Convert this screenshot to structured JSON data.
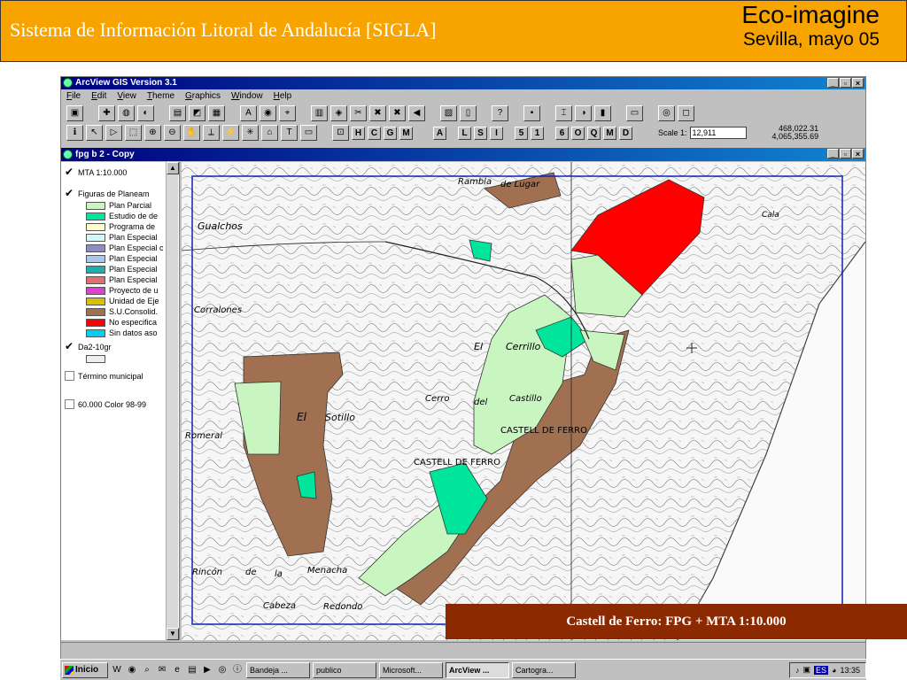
{
  "slide": {
    "title": "Sistema de Información Litoral de Andalucía [SIGLA]",
    "brand": "Eco-imagine",
    "place_date": "Sevilla, mayo 05",
    "caption": "Castell de Ferro: FPG + MTA 1:10.000"
  },
  "app": {
    "title": "ArcView GIS Version 3.1",
    "menu": [
      "File",
      "Edit",
      "View",
      "Theme",
      "Graphics",
      "Window",
      "Help"
    ],
    "letter_buttons": [
      "H",
      "C",
      "G",
      "M",
      "A",
      "L",
      "S",
      "I",
      "5",
      "1",
      "6",
      "O",
      "Q",
      "M",
      "D"
    ],
    "scale_label": "Scale 1:",
    "scale_value": "12,911",
    "coord_x": "468,022.31",
    "coord_y": "4,065,355.69"
  },
  "view": {
    "title": "fpg b 2 - Copy",
    "themes": [
      {
        "label": "MTA 1:10.000",
        "checked": true
      },
      {
        "label": "Figuras de Planeam",
        "checked": true
      },
      {
        "label": "Da2-10gr",
        "checked": true
      },
      {
        "label": "Término municipal",
        "checked": false
      },
      {
        "label": "60.000 Color 98-99",
        "checked": false
      }
    ],
    "legend": [
      {
        "label": "Plan Parcial",
        "color": "#c8f5c0"
      },
      {
        "label": "Estudio de de",
        "color": "#00e59c"
      },
      {
        "label": "Programa de",
        "color": "#ffffc8"
      },
      {
        "label": "Plan Especial",
        "color": "#d0f8f8"
      },
      {
        "label": "Plan Especial c",
        "color": "#8c8cc8"
      },
      {
        "label": "Plan Especial",
        "color": "#a6c8f0"
      },
      {
        "label": "Plan Especial",
        "color": "#1ab0b0"
      },
      {
        "label": "Plan Especial",
        "color": "#e07070"
      },
      {
        "label": "Proyecto de u",
        "color": "#e040d0"
      },
      {
        "label": "Unidad de Eje",
        "color": "#d8c000"
      },
      {
        "label": "S.U.Consolid.",
        "color": "#a07050"
      },
      {
        "label": "No especifica",
        "color": "#ff0000"
      },
      {
        "label": "Sin datos aso",
        "color": "#00d0f0"
      }
    ],
    "map_labels": {
      "gualchos": "Gualchos",
      "corralones": "Corralones",
      "romeral": "Romeral",
      "el": "El",
      "sotillo": "Sotillo",
      "cerrillo": "Cerrillo",
      "cerro": "Cerro",
      "del": "del",
      "castillo": "Castillo",
      "castell1": "CASTELL DE FERRO",
      "castell2": "CASTELL DE FERRO",
      "rincon": "Rincón",
      "de": "de",
      "la": "la",
      "menacha": "Menacha",
      "cabeza": "Cabeza",
      "redondo": "Redondo",
      "rambla": "Rambla",
      "de_lugar": "de Lugar",
      "cala": "Cala"
    }
  },
  "taskbar": {
    "start": "Inicio",
    "tasks": [
      "Bandeja ...",
      "publico",
      "Microsoft...",
      "ArcView ...",
      "Cartogra..."
    ],
    "active_task": "ArcView ...",
    "lang": "ES",
    "time": "13:35"
  }
}
